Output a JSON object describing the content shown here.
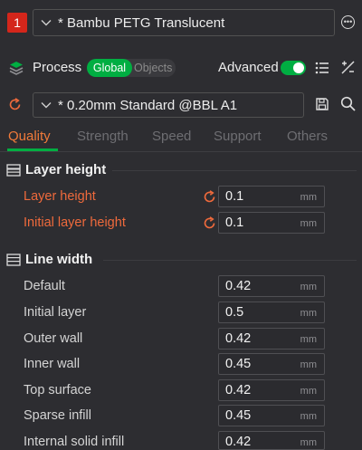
{
  "filament": {
    "index": "1",
    "index_color": "#d4261b",
    "name": "* Bambu PETG Translucent",
    "more_icon": "ellipsis-circle-icon"
  },
  "process": {
    "label": "Process",
    "scope_tabs": [
      {
        "label": "Global",
        "selected": true
      },
      {
        "label": "Objects",
        "selected": false
      }
    ],
    "advanced_label": "Advanced",
    "advanced_on": true,
    "accent": "#00ae42"
  },
  "preset": {
    "name": "* 0.20mm Standard @BBL A1"
  },
  "tabs": [
    {
      "label": "Quality",
      "active": true
    },
    {
      "label": "Strength",
      "active": false
    },
    {
      "label": "Speed",
      "active": false
    },
    {
      "label": "Support",
      "active": false
    },
    {
      "label": "Others",
      "active": false
    }
  ],
  "modified_color": "#ef6a3c",
  "sections": {
    "layer_height": {
      "title": "Layer height",
      "rows": [
        {
          "label": "Layer height",
          "value": "0.1",
          "unit": "mm",
          "modified": true
        },
        {
          "label": "Initial layer height",
          "value": "0.1",
          "unit": "mm",
          "modified": true
        }
      ]
    },
    "line_width": {
      "title": "Line width",
      "rows": [
        {
          "label": "Default",
          "value": "0.42",
          "unit": "mm",
          "modified": false
        },
        {
          "label": "Initial layer",
          "value": "0.5",
          "unit": "mm",
          "modified": false
        },
        {
          "label": "Outer wall",
          "value": "0.42",
          "unit": "mm",
          "modified": false
        },
        {
          "label": "Inner wall",
          "value": "0.45",
          "unit": "mm",
          "modified": false
        },
        {
          "label": "Top surface",
          "value": "0.42",
          "unit": "mm",
          "modified": false
        },
        {
          "label": "Sparse infill",
          "value": "0.45",
          "unit": "mm",
          "modified": false
        },
        {
          "label": "Internal solid infill",
          "value": "0.42",
          "unit": "mm",
          "modified": false
        }
      ]
    }
  }
}
